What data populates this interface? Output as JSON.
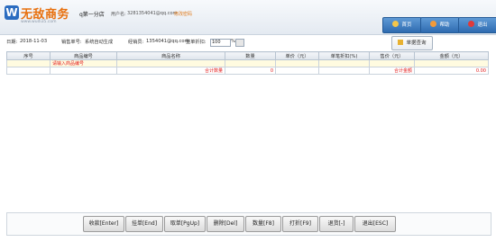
{
  "header": {
    "logo_letter": "W",
    "logo_text": "无敌商务",
    "logo_sub": "www.wudi35.com",
    "store_name": "q第一分店",
    "user_label": "用户名:",
    "user_email": "3281354041@qq.com",
    "change_password": "修改密码",
    "buttons": {
      "home": "首页",
      "help": "帮助",
      "exit": "退出"
    }
  },
  "info": {
    "date_label": "日期:",
    "date_value": "2018-11-03",
    "order_label": "销售单号:",
    "order_value": "系统自动生成",
    "operator_label": "经销员:",
    "operator_value": "1354041@qq.com",
    "discount_label": "整单折扣:",
    "discount_value": "100",
    "discount_unit": "%",
    "query_button": "单据查询"
  },
  "table": {
    "headers": [
      "序号",
      "商品编号",
      "商品名称",
      "数量",
      "单价（元）",
      "单笔折扣(%)",
      "售价（元）",
      "金额（元）"
    ],
    "row1": {
      "code_placeholder": "请输入商品编号"
    },
    "row2": {
      "qty_label": "合计数量",
      "qty_value": "0",
      "amount_label": "合计金额",
      "amount_value": "0.00"
    }
  },
  "footer": {
    "buttons": [
      "收款[Enter]",
      "挂单[End]",
      "取单[PgUp]",
      "删除[Del]",
      "数量[F8]",
      "打折[F9]",
      "退货[-]",
      "退出[ESC]"
    ]
  },
  "colors": {
    "accent": "#2e6bb0",
    "logo_orange": "#e8700e",
    "warning_red": "#e21b1b"
  }
}
